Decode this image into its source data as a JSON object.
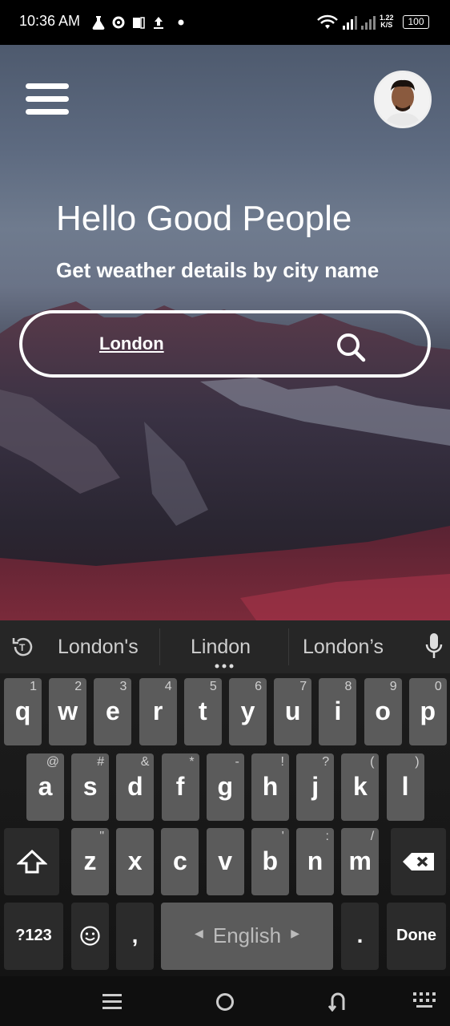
{
  "status": {
    "time": "10:36 AM",
    "speed_top": "1.22",
    "speed_unit": "K/S",
    "battery": "100"
  },
  "header": {
    "menu_icon": "hamburger-menu-icon",
    "avatar_icon": "user-avatar"
  },
  "hero": {
    "title": "Hello Good People",
    "subtitle": "Get weather details by city name"
  },
  "search": {
    "value": "London",
    "icon": "search-icon"
  },
  "keyboard": {
    "suggestions": [
      "London's",
      "Lindon",
      "London’s"
    ],
    "row1": [
      {
        "k": "q",
        "h": "1"
      },
      {
        "k": "w",
        "h": "2"
      },
      {
        "k": "e",
        "h": "3"
      },
      {
        "k": "r",
        "h": "4"
      },
      {
        "k": "t",
        "h": "5"
      },
      {
        "k": "y",
        "h": "6"
      },
      {
        "k": "u",
        "h": "7"
      },
      {
        "k": "i",
        "h": "8"
      },
      {
        "k": "o",
        "h": "9"
      },
      {
        "k": "p",
        "h": "0"
      }
    ],
    "row2": [
      {
        "k": "a",
        "h": "@"
      },
      {
        "k": "s",
        "h": "#"
      },
      {
        "k": "d",
        "h": "&"
      },
      {
        "k": "f",
        "h": "*"
      },
      {
        "k": "g",
        "h": "-"
      },
      {
        "k": "h",
        "h": "!"
      },
      {
        "k": "j",
        "h": "?"
      },
      {
        "k": "k",
        "h": "("
      },
      {
        "k": "l",
        "h": ")"
      }
    ],
    "row3": [
      {
        "k": "z",
        "h": "\""
      },
      {
        "k": "x",
        "h": ""
      },
      {
        "k": "c",
        "h": ""
      },
      {
        "k": "v",
        "h": ""
      },
      {
        "k": "b",
        "h": "'"
      },
      {
        "k": "n",
        "h": ":"
      },
      {
        "k": "m",
        "h": "/"
      }
    ],
    "symbols": "?123",
    "comma": ",",
    "space": "English",
    "period": ".",
    "done": "Done"
  }
}
